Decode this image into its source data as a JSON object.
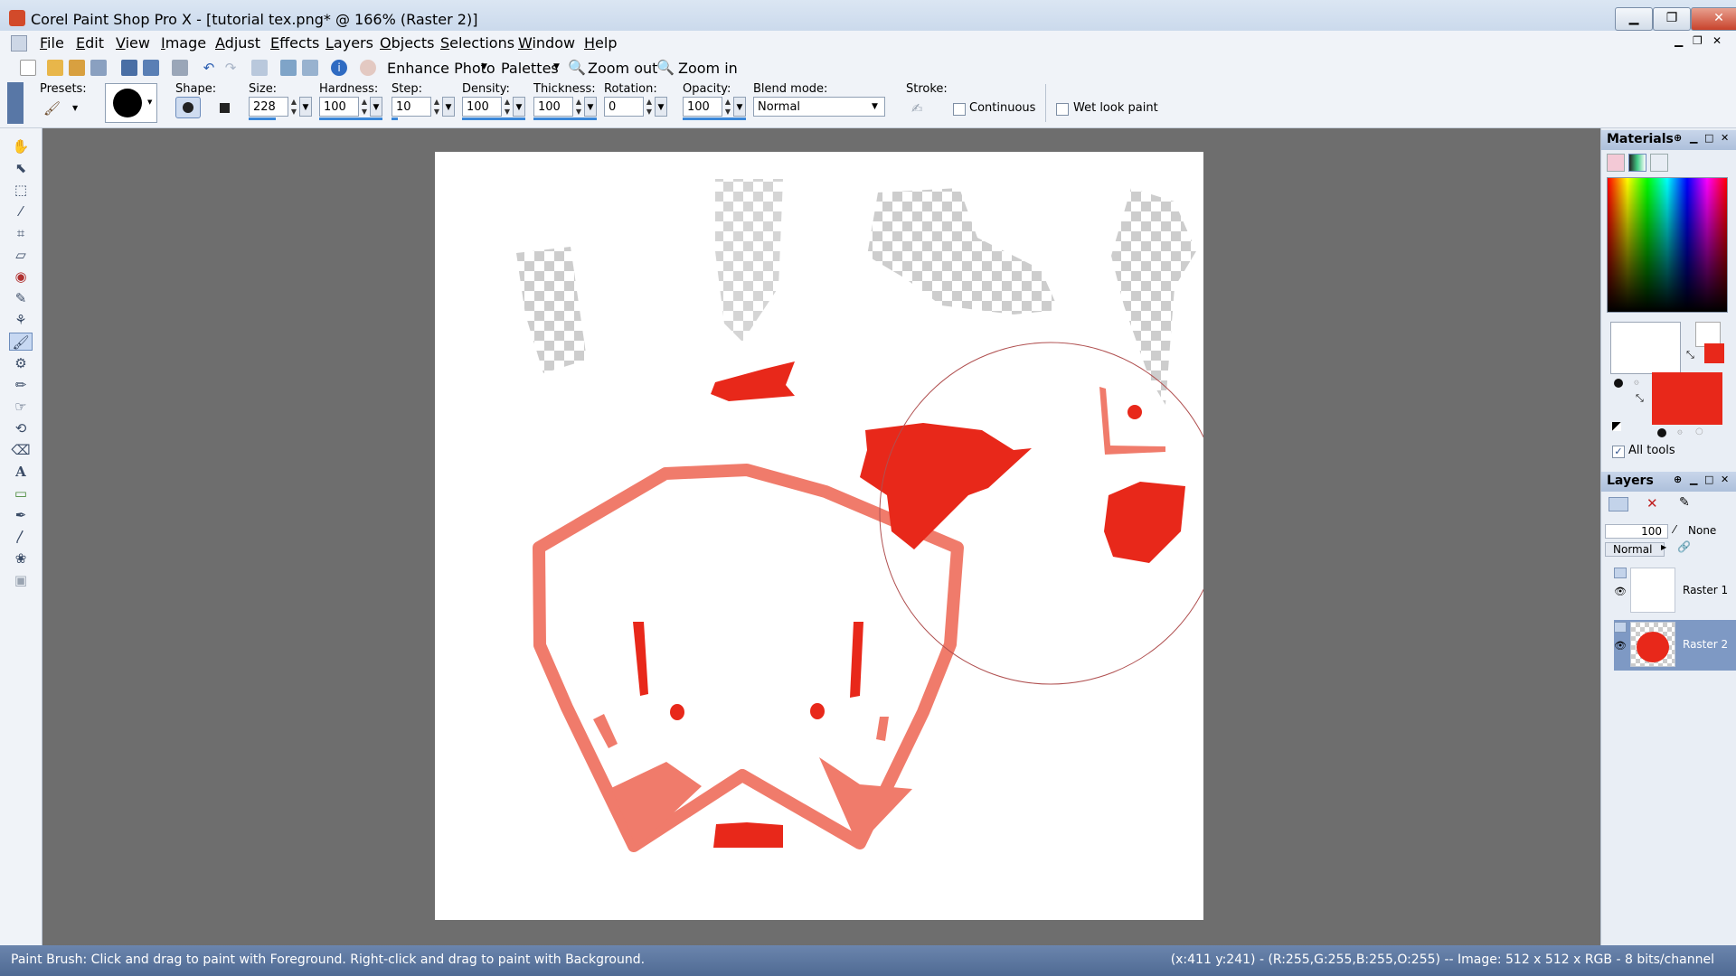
{
  "window": {
    "title": "Corel Paint Shop Pro X - [tutorial tex.png* @ 166% (Raster 2)]"
  },
  "menu": [
    "File",
    "Edit",
    "View",
    "Image",
    "Adjust",
    "Effects",
    "Layers",
    "Objects",
    "Selections",
    "Window",
    "Help"
  ],
  "toolbar": {
    "enhance_photo": "Enhance Photo",
    "palettes": "Palettes",
    "zoom_out": "Zoom out",
    "zoom_in": "Zoom in"
  },
  "options": {
    "presets_label": "Presets:",
    "shape_label": "Shape:",
    "size_label": "Size:",
    "size": "228",
    "hardness_label": "Hardness:",
    "hardness": "100",
    "step_label": "Step:",
    "step": "10",
    "density_label": "Density:",
    "density": "100",
    "thickness_label": "Thickness:",
    "thickness": "100",
    "rotation_label": "Rotation:",
    "rotation": "0",
    "opacity_label": "Opacity:",
    "opacity": "100",
    "blend_label": "Blend mode:",
    "blend": "Normal",
    "stroke_label": "Stroke:",
    "continuous": "Continuous",
    "wet_look": "Wet look paint"
  },
  "materials": {
    "title": "Materials",
    "all_tools": "All tools",
    "fg_color": "#ffffff",
    "bg_color": "#e8281a"
  },
  "layers": {
    "title": "Layers",
    "opacity": "100",
    "mask": "None",
    "blend": "Normal",
    "items": [
      {
        "name": "Raster 1",
        "selected": false
      },
      {
        "name": "Raster 2",
        "selected": true
      }
    ]
  },
  "status": {
    "hint": "Paint Brush: Click and drag to paint with Foreground. Right-click and drag to paint with Background.",
    "info": "(x:411 y:241) - (R:255,G:255,B:255,O:255) -- Image:  512 x 512 x RGB - 8 bits/channel"
  }
}
